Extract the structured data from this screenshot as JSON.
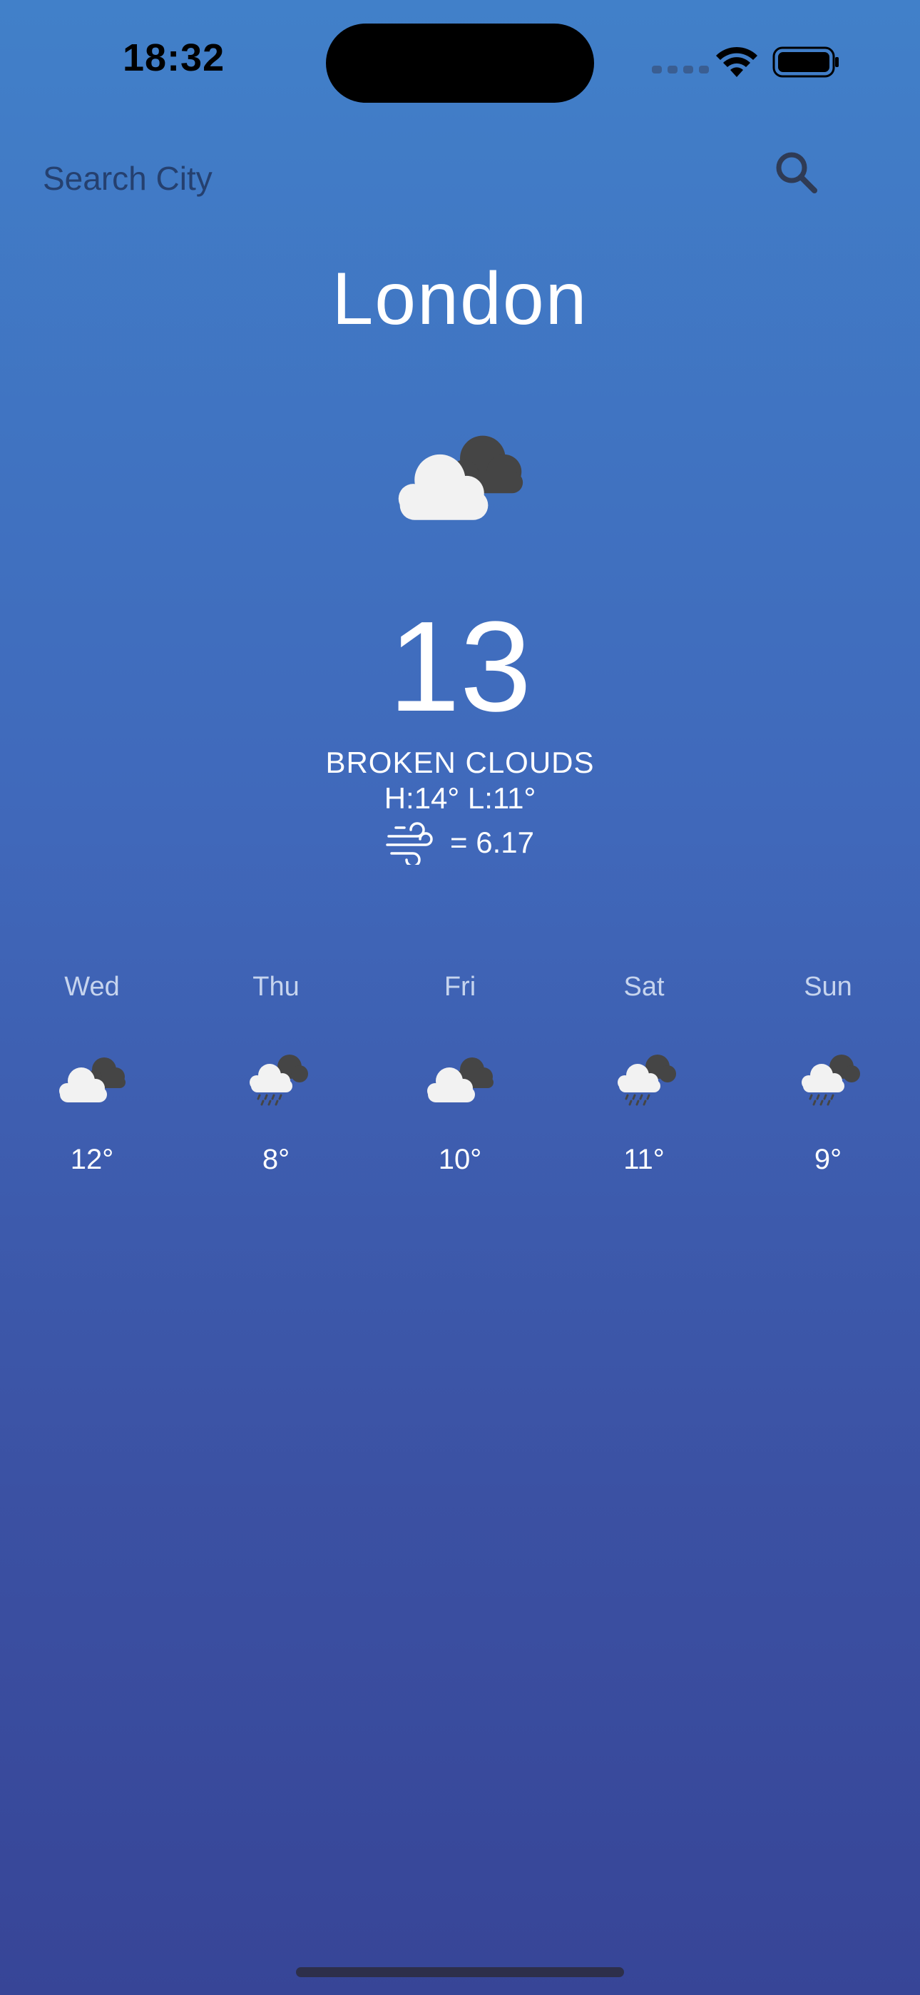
{
  "status_bar": {
    "time": "18:32"
  },
  "search": {
    "placeholder": "Search City",
    "icon": "search-icon"
  },
  "current": {
    "city": "London",
    "icon": "broken-clouds-icon",
    "temperature": "13",
    "description": "BROKEN CLOUDS",
    "hi_lo": "H:14° L:11°",
    "wind_icon": "wind-icon",
    "wind_text": "= 6.17"
  },
  "forecast": [
    {
      "day": "Wed",
      "icon": "broken-clouds-icon",
      "temp": "12°"
    },
    {
      "day": "Thu",
      "icon": "rain-icon",
      "temp": "8°"
    },
    {
      "day": "Fri",
      "icon": "broken-clouds-icon",
      "temp": "10°"
    },
    {
      "day": "Sat",
      "icon": "rain-icon",
      "temp": "11°"
    },
    {
      "day": "Sun",
      "icon": "rain-icon",
      "temp": "9°"
    }
  ],
  "colors": {
    "background_top": "#4180c9",
    "background_bottom": "#374597",
    "cloud_light": "#f2f2f2",
    "cloud_dark": "#454545"
  }
}
